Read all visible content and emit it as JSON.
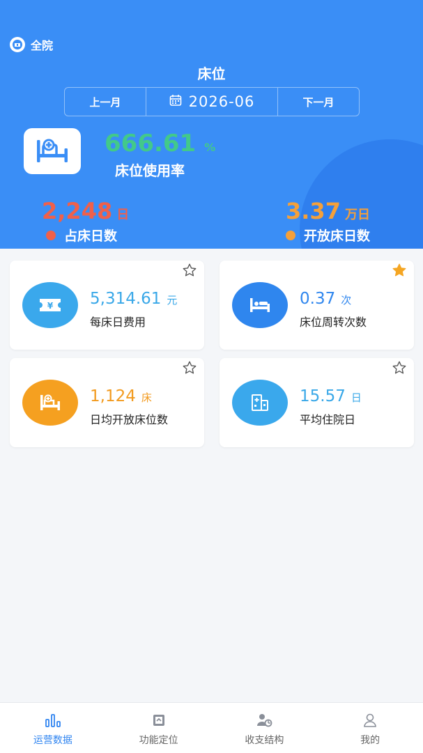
{
  "header": {
    "scope_label": "全院",
    "title": "床位",
    "prev_month_label": "上一月",
    "month_value": "2026-06",
    "next_month_label": "下一月"
  },
  "usage_rate": {
    "value": "666.61",
    "unit": "%",
    "label": "床位使用率"
  },
  "occupied_days": {
    "value": "2,248",
    "unit": "日",
    "label": "占床日数"
  },
  "open_days": {
    "value": "3.37",
    "unit": "万日",
    "label": "开放床日数"
  },
  "cards": [
    {
      "value": "5,314.61",
      "unit": "元",
      "label": "每床日费用",
      "starred": false
    },
    {
      "value": "0.37",
      "unit": "次",
      "label": "床位周转次数",
      "starred": true
    },
    {
      "value": "1,124",
      "unit": "床",
      "label": "日均开放床位数",
      "starred": false
    },
    {
      "value": "15.57",
      "unit": "日",
      "label": "平均住院日",
      "starred": false
    }
  ],
  "tabs": [
    {
      "label": "运营数据",
      "active": true
    },
    {
      "label": "功能定位",
      "active": false
    },
    {
      "label": "收支结构",
      "active": false
    },
    {
      "label": "我的",
      "active": false
    }
  ],
  "colors": {
    "hero_bg": "#3a8ef6",
    "rate_green": "#42c98a",
    "occupied_red": "#f0604a",
    "open_orange": "#f5a03a",
    "card_blue_value": "#3aa8e8",
    "card_orange_value": "#f29a1e",
    "star_active": "#f5a623",
    "tab_active": "#2f84f0"
  },
  "icons": {
    "scope": "hospital-icon",
    "calendar": "calendar-icon",
    "bed": "bed-icon",
    "fee": "ticket-yuan-icon",
    "turnover": "bed-turnover-icon",
    "open_beds": "bed-plus-icon",
    "stay": "building-icon",
    "star": "star-icon"
  }
}
